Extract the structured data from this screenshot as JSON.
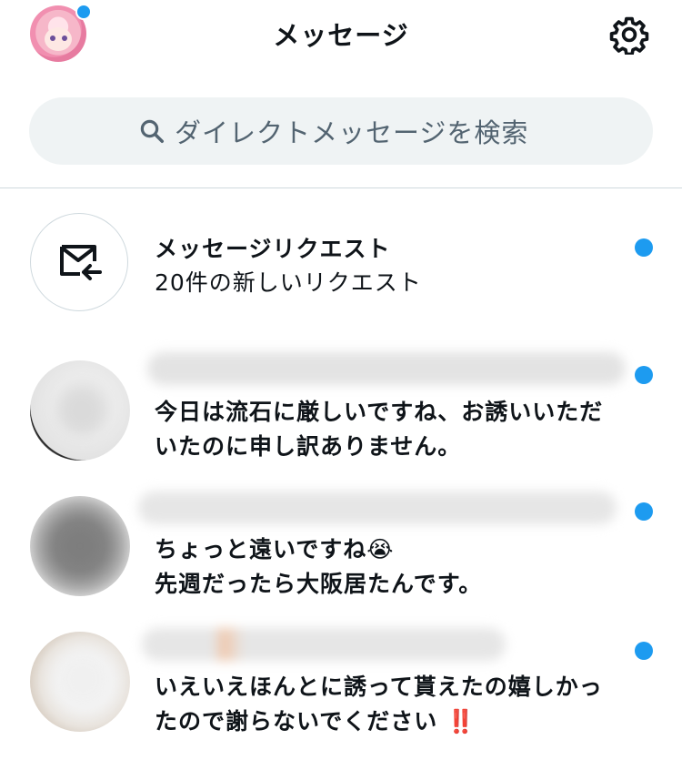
{
  "header": {
    "title": "メッセージ",
    "settings_icon": "gear-icon"
  },
  "search": {
    "placeholder": "ダイレクトメッセージを検索",
    "icon": "search-icon"
  },
  "message_requests": {
    "title": "メッセージリクエスト",
    "subtitle": "20件の新しいリクエスト",
    "icon": "envelope-arrow-icon"
  },
  "conversations": [
    {
      "line1": "今日は流石に厳しいですね、お誘いいただ",
      "line2": "いたのに申し訳ありません。",
      "unread": true
    },
    {
      "line1": "ちょっと遠いですね",
      "line1_emoji": "😭",
      "line2": "先週だったら大阪居たんです。",
      "unread": true
    },
    {
      "line1": "いえいえほんとに誘って貰えたの嬉しかっ",
      "line2": "たので謝らないでください",
      "line2_emoji": "‼️",
      "unread": true
    }
  ],
  "colors": {
    "accent": "#1d9bf0",
    "search_bg": "#eff3f4",
    "divider": "#cfd9de",
    "muted_text": "#536471"
  }
}
